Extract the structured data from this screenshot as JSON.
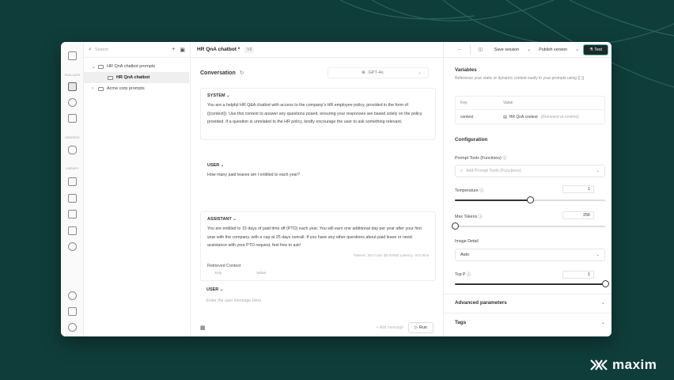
{
  "brand": {
    "name": "maxim",
    "accent": "#5ab5ac",
    "background": "#0f3d3a"
  },
  "rail": {
    "labels": [
      "EVALUATE",
      "OBSERVE",
      "LIBRARY"
    ],
    "icons": [
      "home-icon",
      "prompt-icon",
      "phone-icon",
      "workflow-icon",
      "database-icon",
      "context-icon",
      "tool-icon",
      "dataset-icon",
      "evaluator-icon",
      "settings-icon",
      "magic-icon",
      "docs-icon",
      "gear-icon"
    ]
  },
  "tree": {
    "search_placeholder": "Search",
    "items": [
      {
        "label": "HR QnA chatbot prompts",
        "expanded": true
      },
      {
        "label": "HR QnA chatbot",
        "child": true
      },
      {
        "label": "Acme corp prompts",
        "expanded": false
      }
    ]
  },
  "header": {
    "title": "HR QnA chatbot *",
    "version": "V6"
  },
  "conversation": {
    "title": "Conversation",
    "model": "GPT-4o",
    "system": {
      "role": "SYSTEM",
      "text": "You are a helpful HR Q&A chatbot with access to the company's HR employee policy, provided in the form of {{context}}. Use this context to answer any questions posed, ensuring your responses are based solely on the policy provided. If a question is unrelated to the HR policy, kindly encourage the user to ask something relevant."
    },
    "user": {
      "role": "USER",
      "text": "How many paid leaves am I entitled to each year?"
    },
    "assistant": {
      "role": "ASSISTANT",
      "text": "You are entitled to 15 days of paid time off (PTO) each year. You will earn one additional day per year after your first year with the company, with a cap at 25 days overall. If you have any other questions about paid leave or need assistance with your PTO request, feel free to ask!",
      "meta": "Tokens: 304    Cost: $0.00050    Latency: 972.8ms",
      "retrieved_context": "Retrieved Context",
      "kv_headers": [
        "Key",
        "Value"
      ]
    },
    "new_user": {
      "role": "USER",
      "placeholder": "Enter the user message Here"
    },
    "add_message": "+ Add message",
    "run": "Run"
  },
  "toolbar": {
    "save": "Save session",
    "publish": "Publish version",
    "test": "Test"
  },
  "variables": {
    "title": "Variables",
    "desc": "Reference your static or dynamic context easily in your prompts using {{ }}",
    "headers": [
      "Key",
      "Value"
    ],
    "rows": [
      {
        "key": "context",
        "value": "HR QnA context",
        "note": "(Retrieved at runtime)"
      }
    ]
  },
  "configuration": {
    "title": "Configuration",
    "prompt_tools": {
      "label": "Prompt Tools (Functions)",
      "placeholder": "Add Prompt Tools (Functions)"
    },
    "temperature": {
      "label": "Temperature",
      "value": 1,
      "fraction": 0.5
    },
    "max_tokens": {
      "label": "Max Tokens",
      "value": 256,
      "fraction": 0.0
    },
    "image_detail": {
      "label": "Image Detail",
      "value": "Auto"
    },
    "top_p": {
      "label": "Top P",
      "value": 1,
      "fraction": 1.0
    }
  },
  "advanced": "Advanced parameters",
  "tags": "Tags"
}
